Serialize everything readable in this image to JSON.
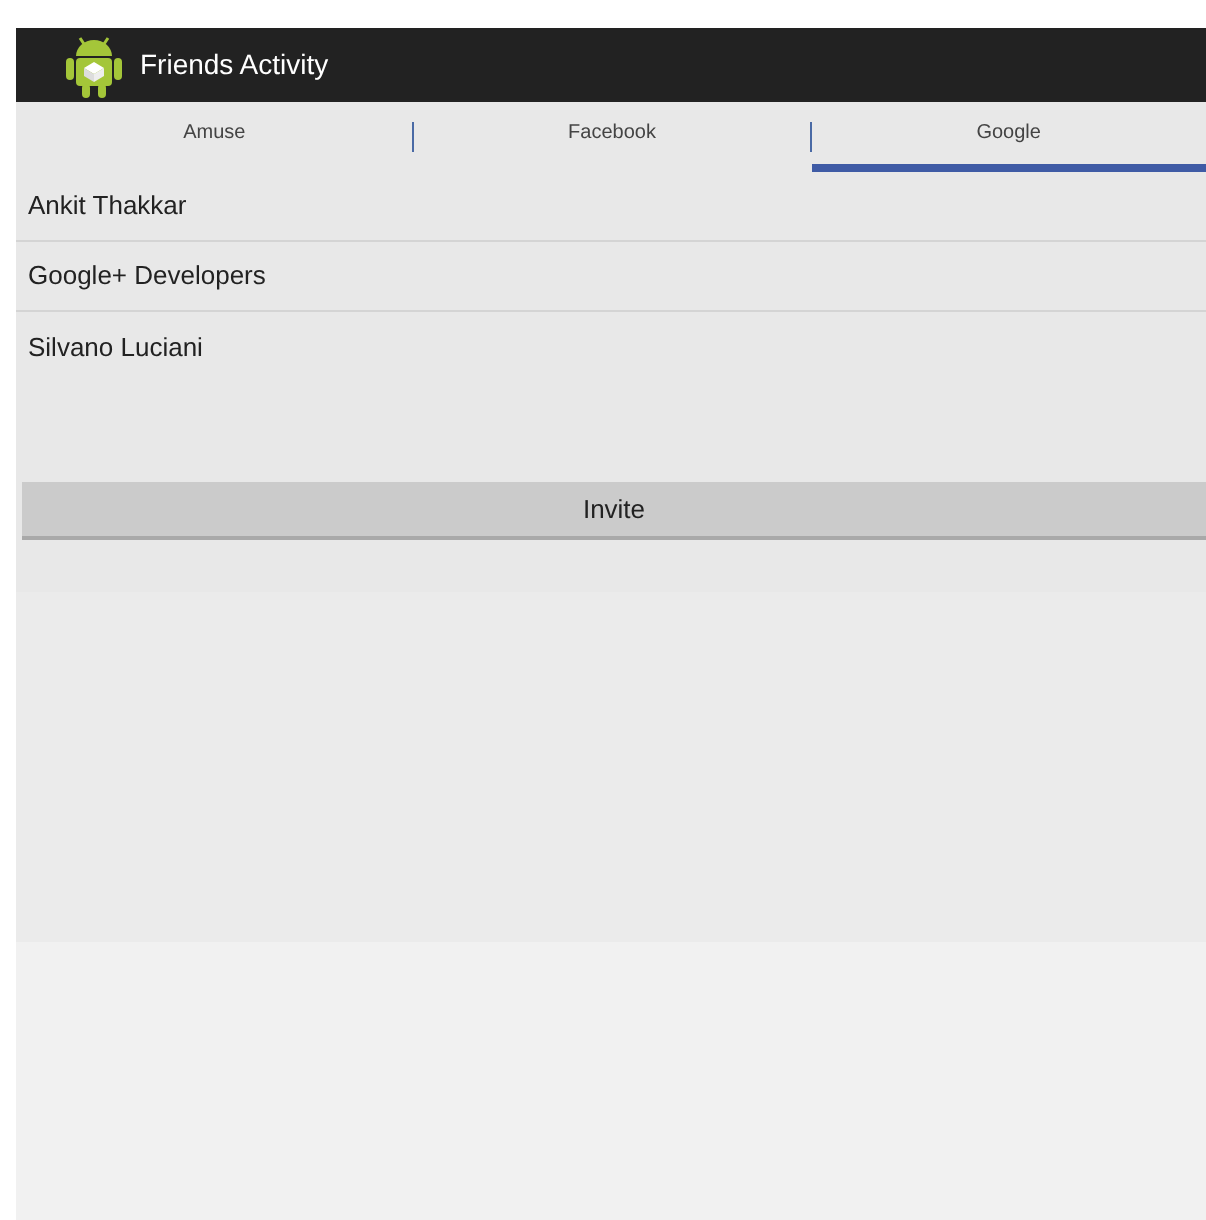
{
  "action_bar": {
    "title": "Friends Activity"
  },
  "tabs": [
    {
      "label": "Amuse",
      "selected": false
    },
    {
      "label": "Facebook",
      "selected": false
    },
    {
      "label": "Google",
      "selected": true
    }
  ],
  "friends": [
    {
      "name": "Ankit Thakkar"
    },
    {
      "name": "Google+ Developers"
    },
    {
      "name": "Silvano Luciani"
    }
  ],
  "invite_button": "Invite"
}
